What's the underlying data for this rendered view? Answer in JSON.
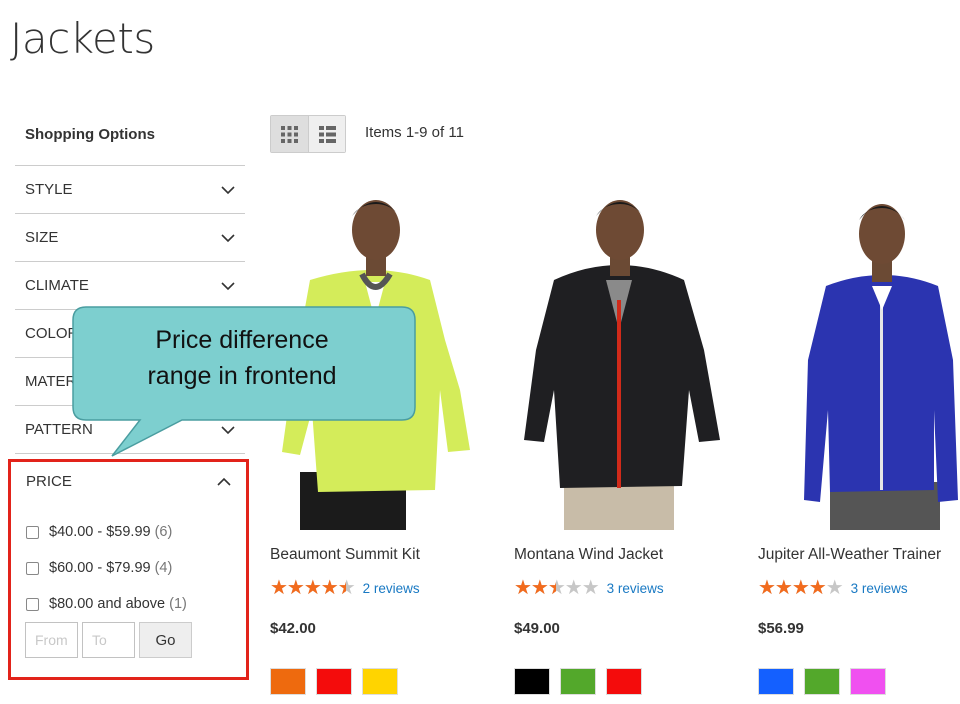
{
  "page": {
    "title": "Jackets"
  },
  "sidebar": {
    "heading": "Shopping Options",
    "filters": [
      {
        "label": "STYLE"
      },
      {
        "label": "SIZE"
      },
      {
        "label": "CLIMATE"
      },
      {
        "label": "COLOR"
      },
      {
        "label": "MATERIAL"
      },
      {
        "label": "PATTERN"
      }
    ],
    "price": {
      "label": "PRICE",
      "options": [
        {
          "range": "$40.00 - $59.99",
          "count": "(6)"
        },
        {
          "range": "$60.00 - $79.99",
          "count": "(4)"
        },
        {
          "range": "$80.00 and above",
          "count": "(1)"
        }
      ],
      "from_placeholder": "From",
      "to_placeholder": "To",
      "go_label": "Go"
    }
  },
  "toolbar": {
    "items_count": "Items 1-9 of 11",
    "view_modes": [
      "grid",
      "list"
    ],
    "active_view": "grid"
  },
  "callout": {
    "line1": "Price difference",
    "line2": "range in frontend"
  },
  "products": [
    {
      "name": "Beaumont Summit Kit",
      "rating": 4.5,
      "reviews": "2 reviews",
      "price": "$42.00",
      "jacket_color": "#d4ec5a",
      "swatches": [
        "#ee6a0e",
        "#f40c0c",
        "#ffd400"
      ]
    },
    {
      "name": "Montana Wind Jacket",
      "rating": 2.5,
      "reviews": "3 reviews",
      "price": "$49.00",
      "jacket_color": "#1f1f22",
      "swatches": [
        "#000000",
        "#53a82b",
        "#f40c0c"
      ]
    },
    {
      "name": "Jupiter All-Weather Trainer",
      "rating": 4,
      "reviews": "3 reviews",
      "price": "$56.99",
      "jacket_color": "#2b34b0",
      "swatches": [
        "#1460ff",
        "#53a82b",
        "#f050f0"
      ]
    }
  ],
  "colors": {
    "accent_star": "#f26b1d",
    "link": "#1979c3",
    "highlight_border": "#e2231a",
    "callout_fill": "#7dcfcf"
  }
}
